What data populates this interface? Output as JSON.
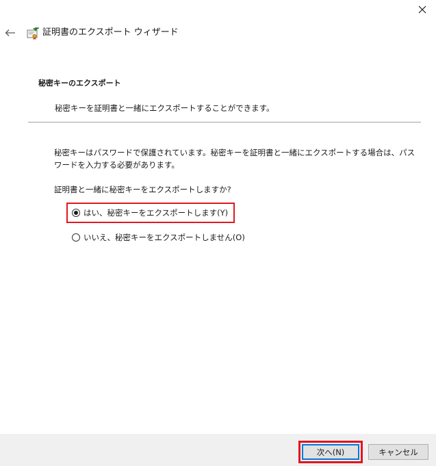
{
  "window": {
    "title": "証明書のエクスポート ウィザード"
  },
  "icons": {
    "close": "close-icon",
    "back": "back-arrow-icon",
    "app": "certificate-icon"
  },
  "section": {
    "heading": "秘密キーのエクスポート",
    "description": "秘密キーを証明書と一緒にエクスポートすることができます。"
  },
  "content": {
    "body": "秘密キーはパスワードで保護されています。秘密キーを証明書と一緒にエクスポートする場合は、パスワードを入力する必要があります。",
    "question": "証明書と一緒に秘密キーをエクスポートしますか?",
    "options": [
      {
        "label": "はい、秘密キーをエクスポートします(Y)",
        "checked": true
      },
      {
        "label": "いいえ、秘密キーをエクスポートしません(O)",
        "checked": false
      }
    ]
  },
  "footer": {
    "next_label": "次へ(N)",
    "cancel_label": "キャンセル"
  },
  "colors": {
    "highlight": "#e0161e",
    "focus": "#0078d7",
    "footer_bg": "#f0f0f0"
  }
}
